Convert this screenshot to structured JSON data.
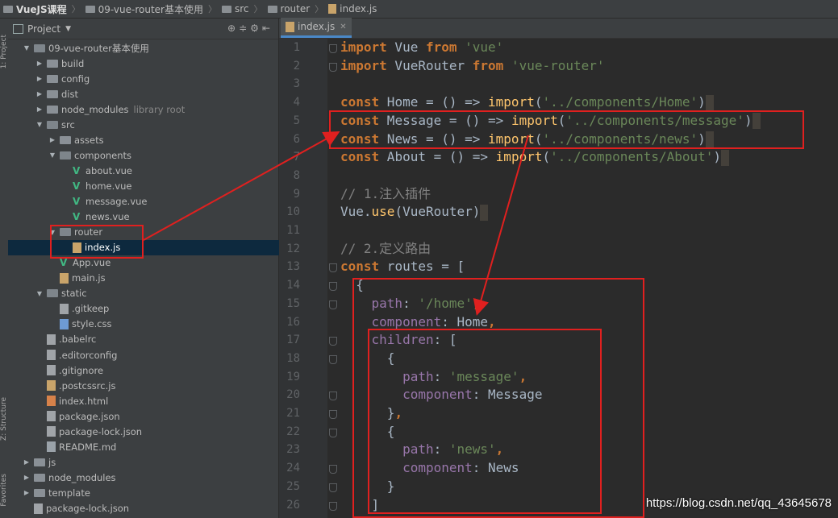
{
  "breadcrumb": [
    "VueJS课程",
    "09-vue-router基本使用",
    "src",
    "router",
    "index.js"
  ],
  "project_panel": {
    "title": "Project",
    "side_labels": [
      "1: Project",
      "Z: Structure",
      "Favorites"
    ],
    "tree": [
      {
        "label": "09-vue-router基本使用",
        "indent": 1,
        "type": "folder",
        "expanded": true
      },
      {
        "label": "build",
        "indent": 2,
        "type": "folder"
      },
      {
        "label": "config",
        "indent": 2,
        "type": "folder"
      },
      {
        "label": "dist",
        "indent": 2,
        "type": "folder"
      },
      {
        "label": "node_modules",
        "hint": "library root",
        "indent": 2,
        "type": "folder"
      },
      {
        "label": "src",
        "indent": 2,
        "type": "folder",
        "expanded": true
      },
      {
        "label": "assets",
        "indent": 3,
        "type": "folder"
      },
      {
        "label": "components",
        "indent": 3,
        "type": "folder",
        "expanded": true
      },
      {
        "label": "about.vue",
        "indent": 4,
        "type": "vue"
      },
      {
        "label": "home.vue",
        "indent": 4,
        "type": "vue"
      },
      {
        "label": "message.vue",
        "indent": 4,
        "type": "vue"
      },
      {
        "label": "news.vue",
        "indent": 4,
        "type": "vue"
      },
      {
        "label": "router",
        "indent": 3,
        "type": "folder",
        "expanded": true
      },
      {
        "label": "index.js",
        "indent": 4,
        "type": "js",
        "selected": true
      },
      {
        "label": "App.vue",
        "indent": 3,
        "type": "vue"
      },
      {
        "label": "main.js",
        "indent": 3,
        "type": "js"
      },
      {
        "label": "static",
        "indent": 2,
        "type": "folder",
        "expanded": true
      },
      {
        "label": ".gitkeep",
        "indent": 3,
        "type": "gen"
      },
      {
        "label": "style.css",
        "indent": 3,
        "type": "css"
      },
      {
        "label": ".babelrc",
        "indent": 2,
        "type": "gen"
      },
      {
        "label": ".editorconfig",
        "indent": 2,
        "type": "gen"
      },
      {
        "label": ".gitignore",
        "indent": 2,
        "type": "gen"
      },
      {
        "label": ".postcssrc.js",
        "indent": 2,
        "type": "js"
      },
      {
        "label": "index.html",
        "indent": 2,
        "type": "html"
      },
      {
        "label": "package.json",
        "indent": 2,
        "type": "gen"
      },
      {
        "label": "package-lock.json",
        "indent": 2,
        "type": "gen"
      },
      {
        "label": "README.md",
        "indent": 2,
        "type": "md"
      },
      {
        "label": "js",
        "indent": 1,
        "type": "folder"
      },
      {
        "label": "node_modules",
        "indent": 1,
        "type": "folder"
      },
      {
        "label": "template",
        "indent": 1,
        "type": "folder"
      },
      {
        "label": "package-lock.json",
        "indent": 1,
        "type": "gen"
      }
    ]
  },
  "editor": {
    "tab": "index.js",
    "lines": [
      [
        [
          "kw",
          "import"
        ],
        [
          "t",
          " Vue "
        ],
        [
          "kw",
          "from"
        ],
        [
          "t",
          " "
        ],
        [
          "str",
          "'vue'"
        ]
      ],
      [
        [
          "kw",
          "import"
        ],
        [
          "t",
          " VueRouter "
        ],
        [
          "kw",
          "from"
        ],
        [
          "t",
          " "
        ],
        [
          "str",
          "'vue-router'"
        ]
      ],
      [],
      [
        [
          "kw",
          "const"
        ],
        [
          "t",
          " Home = () => "
        ],
        [
          "fn",
          "import"
        ],
        [
          "t",
          "("
        ],
        [
          "str",
          "'../components/Home'"
        ],
        [
          "t",
          ")"
        ],
        [
          "cur",
          ""
        ]
      ],
      [
        [
          "kw",
          "const"
        ],
        [
          "t",
          " Message = () => "
        ],
        [
          "fn",
          "import"
        ],
        [
          "t",
          "("
        ],
        [
          "str",
          "'../components/message'"
        ],
        [
          "t",
          ")"
        ],
        [
          "cur",
          ""
        ]
      ],
      [
        [
          "kw",
          "const"
        ],
        [
          "t",
          " News = () => "
        ],
        [
          "fn",
          "import"
        ],
        [
          "t",
          "("
        ],
        [
          "str",
          "'../components/news'"
        ],
        [
          "t",
          ")"
        ],
        [
          "cur",
          ""
        ]
      ],
      [
        [
          "kw",
          "const"
        ],
        [
          "t",
          " About = () => "
        ],
        [
          "fn",
          "import"
        ],
        [
          "t",
          "("
        ],
        [
          "str",
          "'../components/About'"
        ],
        [
          "t",
          ")"
        ],
        [
          "cur",
          ""
        ]
      ],
      [],
      [
        [
          "cmt",
          "// 1.注入插件"
        ]
      ],
      [
        [
          "t",
          "Vue."
        ],
        [
          "fn",
          "use"
        ],
        [
          "t",
          "(VueRouter)"
        ],
        [
          "cur",
          ""
        ]
      ],
      [],
      [
        [
          "cmt",
          "// 2.定义路由"
        ]
      ],
      [
        [
          "kw",
          "const"
        ],
        [
          "t",
          " routes = ["
        ]
      ],
      [
        [
          "t",
          "  {"
        ]
      ],
      [
        [
          "t",
          "    "
        ],
        [
          "prop",
          "path"
        ],
        [
          "t",
          ": "
        ],
        [
          "str",
          "'/home'"
        ],
        [
          "kw",
          ","
        ]
      ],
      [
        [
          "t",
          "    "
        ],
        [
          "prop",
          "component"
        ],
        [
          "t",
          ": Home"
        ],
        [
          "kw",
          ","
        ]
      ],
      [
        [
          "t",
          "    "
        ],
        [
          "prop",
          "children"
        ],
        [
          "t",
          ": ["
        ]
      ],
      [
        [
          "t",
          "      {"
        ]
      ],
      [
        [
          "t",
          "        "
        ],
        [
          "prop",
          "path"
        ],
        [
          "t",
          ": "
        ],
        [
          "str",
          "'message'"
        ],
        [
          "kw",
          ","
        ]
      ],
      [
        [
          "t",
          "        "
        ],
        [
          "prop",
          "component"
        ],
        [
          "t",
          ": Message"
        ]
      ],
      [
        [
          "t",
          "      }"
        ],
        [
          "kw",
          ","
        ]
      ],
      [
        [
          "t",
          "      {"
        ]
      ],
      [
        [
          "t",
          "        "
        ],
        [
          "prop",
          "path"
        ],
        [
          "t",
          ": "
        ],
        [
          "str",
          "'news'"
        ],
        [
          "kw",
          ","
        ]
      ],
      [
        [
          "t",
          "        "
        ],
        [
          "prop",
          "component"
        ],
        [
          "t",
          ": News"
        ]
      ],
      [
        [
          "t",
          "      }"
        ]
      ],
      [
        [
          "t",
          "    ]"
        ]
      ]
    ]
  },
  "watermark": "https://blog.csdn.net/qq_43645678",
  "colors": {
    "highlight": "#e0201f",
    "keyword": "#cc7832",
    "string": "#6a8759"
  }
}
